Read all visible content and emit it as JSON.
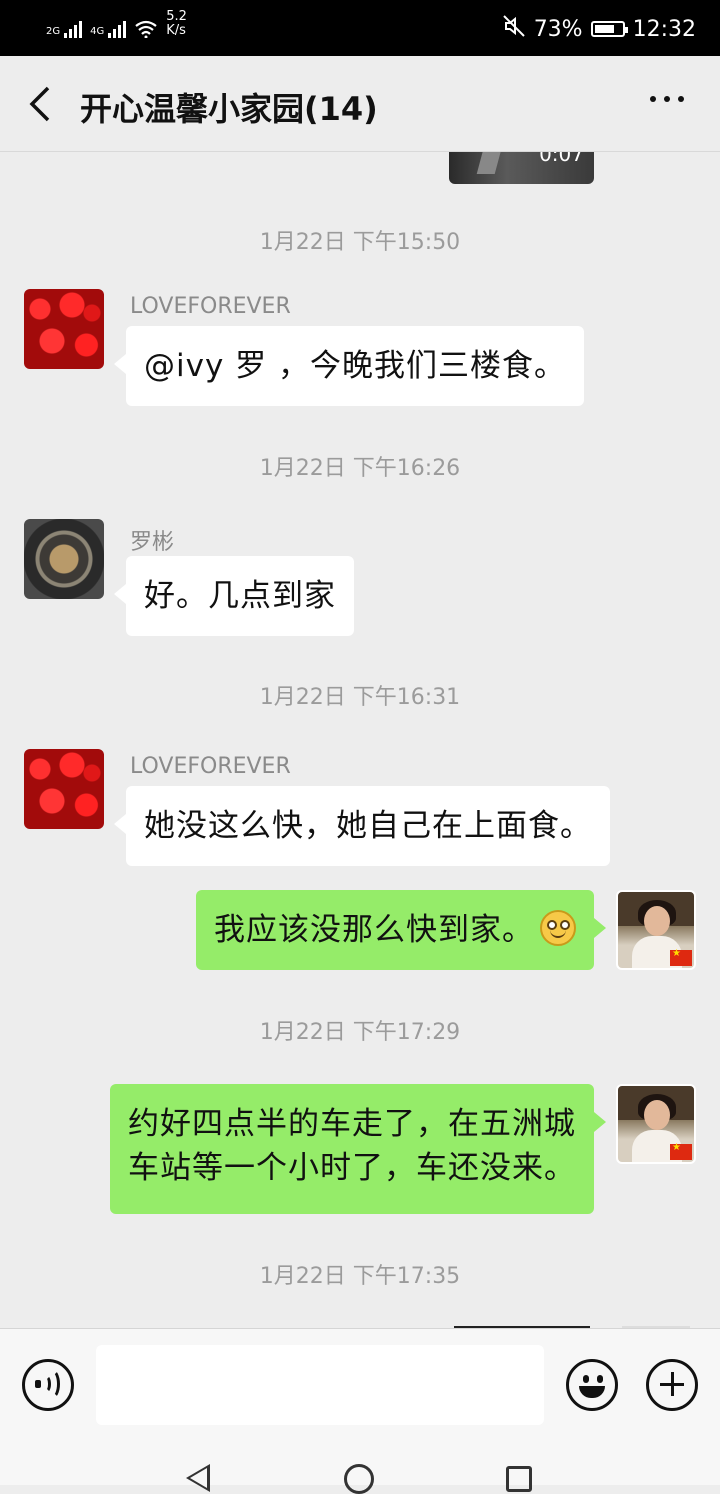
{
  "status_bar": {
    "signal1_label": "2G",
    "signal2_label": "4G",
    "speed_value": "5.2",
    "speed_unit": "K/s",
    "battery": "73%",
    "battery_level": 0.73,
    "time": "12:32"
  },
  "header": {
    "title": "开心温馨小家园(14)"
  },
  "chat": {
    "video_duration": "0:07",
    "timestamps": [
      "1月22日 下午15:50",
      "1月22日 下午16:26",
      "1月22日 下午16:31",
      "1月22日 下午17:29",
      "1月22日 下午17:35"
    ],
    "messages": [
      {
        "sender": "LOVEFOREVER",
        "text": "@ivy 罗 ，今晚我们三楼食。",
        "side": "left",
        "avatar": "roses-avatar"
      },
      {
        "sender": "罗彬",
        "text": "好。几点到家",
        "side": "left",
        "avatar": "coin-avatar"
      },
      {
        "sender": "LOVEFOREVER",
        "text": "她没这么快，她自己在上面食。",
        "side": "left",
        "avatar": "roses-avatar"
      },
      {
        "sender": "",
        "text": "我应该没那么快到家。",
        "side": "right",
        "avatar": "self-avatar",
        "emoji": "smile-emoji"
      },
      {
        "sender": "",
        "text_line1": "约好四点半的车走了，在五洲城",
        "text_line2": "车站等一个小时了，车还没来。",
        "side": "right",
        "avatar": "self-avatar"
      }
    ]
  },
  "input_bar": {
    "value": "",
    "placeholder": ""
  },
  "icons": [
    "back-arrow-icon",
    "more-icon",
    "voice-icon",
    "emoji-icon",
    "plus-icon",
    "nav-back-icon",
    "nav-home-icon",
    "nav-recents-icon"
  ],
  "colors": {
    "my_bubble": "#95ec69",
    "other_bubble": "#ffffff",
    "background": "#ededed"
  }
}
